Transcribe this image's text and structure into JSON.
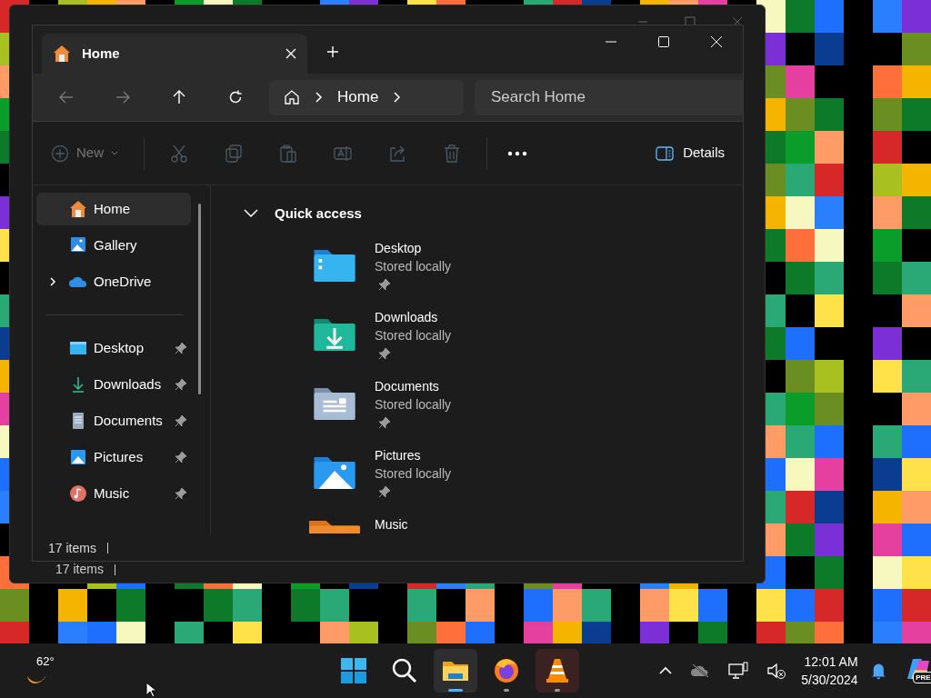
{
  "back_window": {
    "status": "17 items"
  },
  "window": {
    "tabs": [
      {
        "label": "Home",
        "selected": true
      }
    ],
    "breadcrumb": [
      "Home"
    ],
    "search": {
      "placeholder": "Search Home"
    },
    "toolbar": [
      {
        "kind": "new",
        "label": "New",
        "disabled": true
      },
      {
        "kind": "cut",
        "disabled": true
      },
      {
        "kind": "copy",
        "disabled": true
      },
      {
        "kind": "paste",
        "disabled": true
      },
      {
        "kind": "rename",
        "disabled": true
      },
      {
        "kind": "share",
        "disabled": true
      },
      {
        "kind": "delete",
        "disabled": true
      },
      {
        "kind": "more",
        "disabled": false
      },
      {
        "kind": "details",
        "label": "Details",
        "disabled": false
      }
    ],
    "sidebar": {
      "top": [
        {
          "kind": "home",
          "label": "Home",
          "selected": true
        },
        {
          "kind": "gallery",
          "label": "Gallery",
          "selected": false
        },
        {
          "kind": "onedrive",
          "label": "OneDrive",
          "selected": false,
          "expanded": false
        }
      ],
      "pinned": [
        {
          "kind": "desktop",
          "label": "Desktop",
          "selected": false,
          "pinned": true
        },
        {
          "kind": "downloads",
          "label": "Downloads",
          "selected": false,
          "pinned": true
        },
        {
          "kind": "documents",
          "label": "Documents",
          "selected": false,
          "pinned": true
        },
        {
          "kind": "pictures",
          "label": "Pictures",
          "selected": false,
          "pinned": true
        },
        {
          "kind": "music",
          "label": "Music",
          "selected": false,
          "pinned": true
        }
      ]
    },
    "quick_access": {
      "label": "Quick access",
      "expanded": true,
      "items": [
        {
          "kind": "desktop",
          "name": "Desktop",
          "subtitle": "Stored locally",
          "pinned": true
        },
        {
          "kind": "downloads",
          "name": "Downloads",
          "subtitle": "Stored locally",
          "pinned": true
        },
        {
          "kind": "documents",
          "name": "Documents",
          "subtitle": "Stored locally",
          "pinned": true
        },
        {
          "kind": "pictures",
          "name": "Pictures",
          "subtitle": "Stored locally",
          "pinned": true
        },
        {
          "kind": "music",
          "name": "Music"
        }
      ]
    },
    "status": "17 items"
  },
  "taskbar": {
    "weather": "62°",
    "apps": [
      {
        "kind": "start",
        "running": false,
        "active": false
      },
      {
        "kind": "search",
        "running": false,
        "active": false
      },
      {
        "kind": "explorer",
        "running": true,
        "active": true
      },
      {
        "kind": "firefox",
        "running": true,
        "active": false
      },
      {
        "kind": "vlc",
        "running": true,
        "active": false
      }
    ],
    "time": "12:01 AM",
    "date": "5/30/2024",
    "copilot_badge": "PRE"
  }
}
